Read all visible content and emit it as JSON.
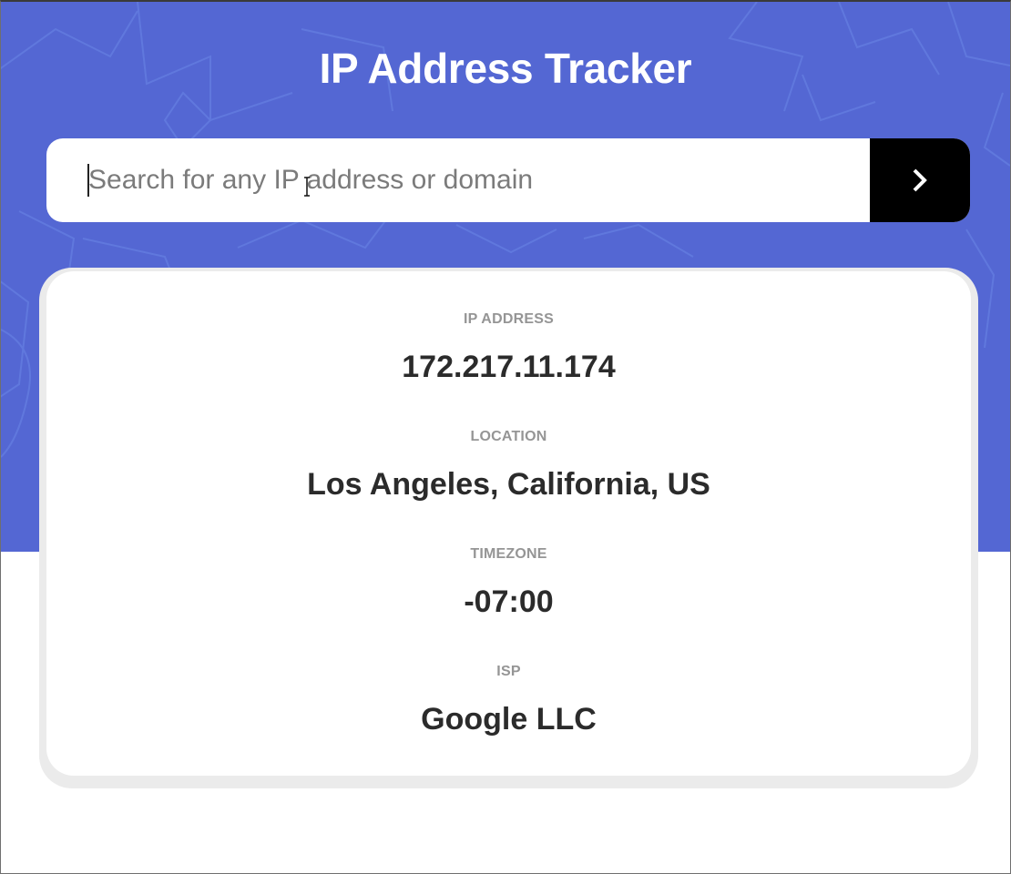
{
  "header": {
    "title": "IP Address Tracker"
  },
  "search": {
    "placeholder": "Search for any IP address or domain",
    "value": "",
    "submit_icon": "chevron-right-icon"
  },
  "stats": [
    {
      "label": "IP ADDRESS",
      "value": "172.217.11.174"
    },
    {
      "label": "LOCATION",
      "value": "Los Angeles, California, US"
    },
    {
      "label": "TIMEZONE",
      "value": "-07:00"
    },
    {
      "label": "ISP",
      "value": "Google LLC"
    }
  ],
  "colors": {
    "hero_background": "#5467d3",
    "pattern": "#6a86e6",
    "label": "#959595",
    "value": "#2b2b2b",
    "button": "#000000"
  }
}
